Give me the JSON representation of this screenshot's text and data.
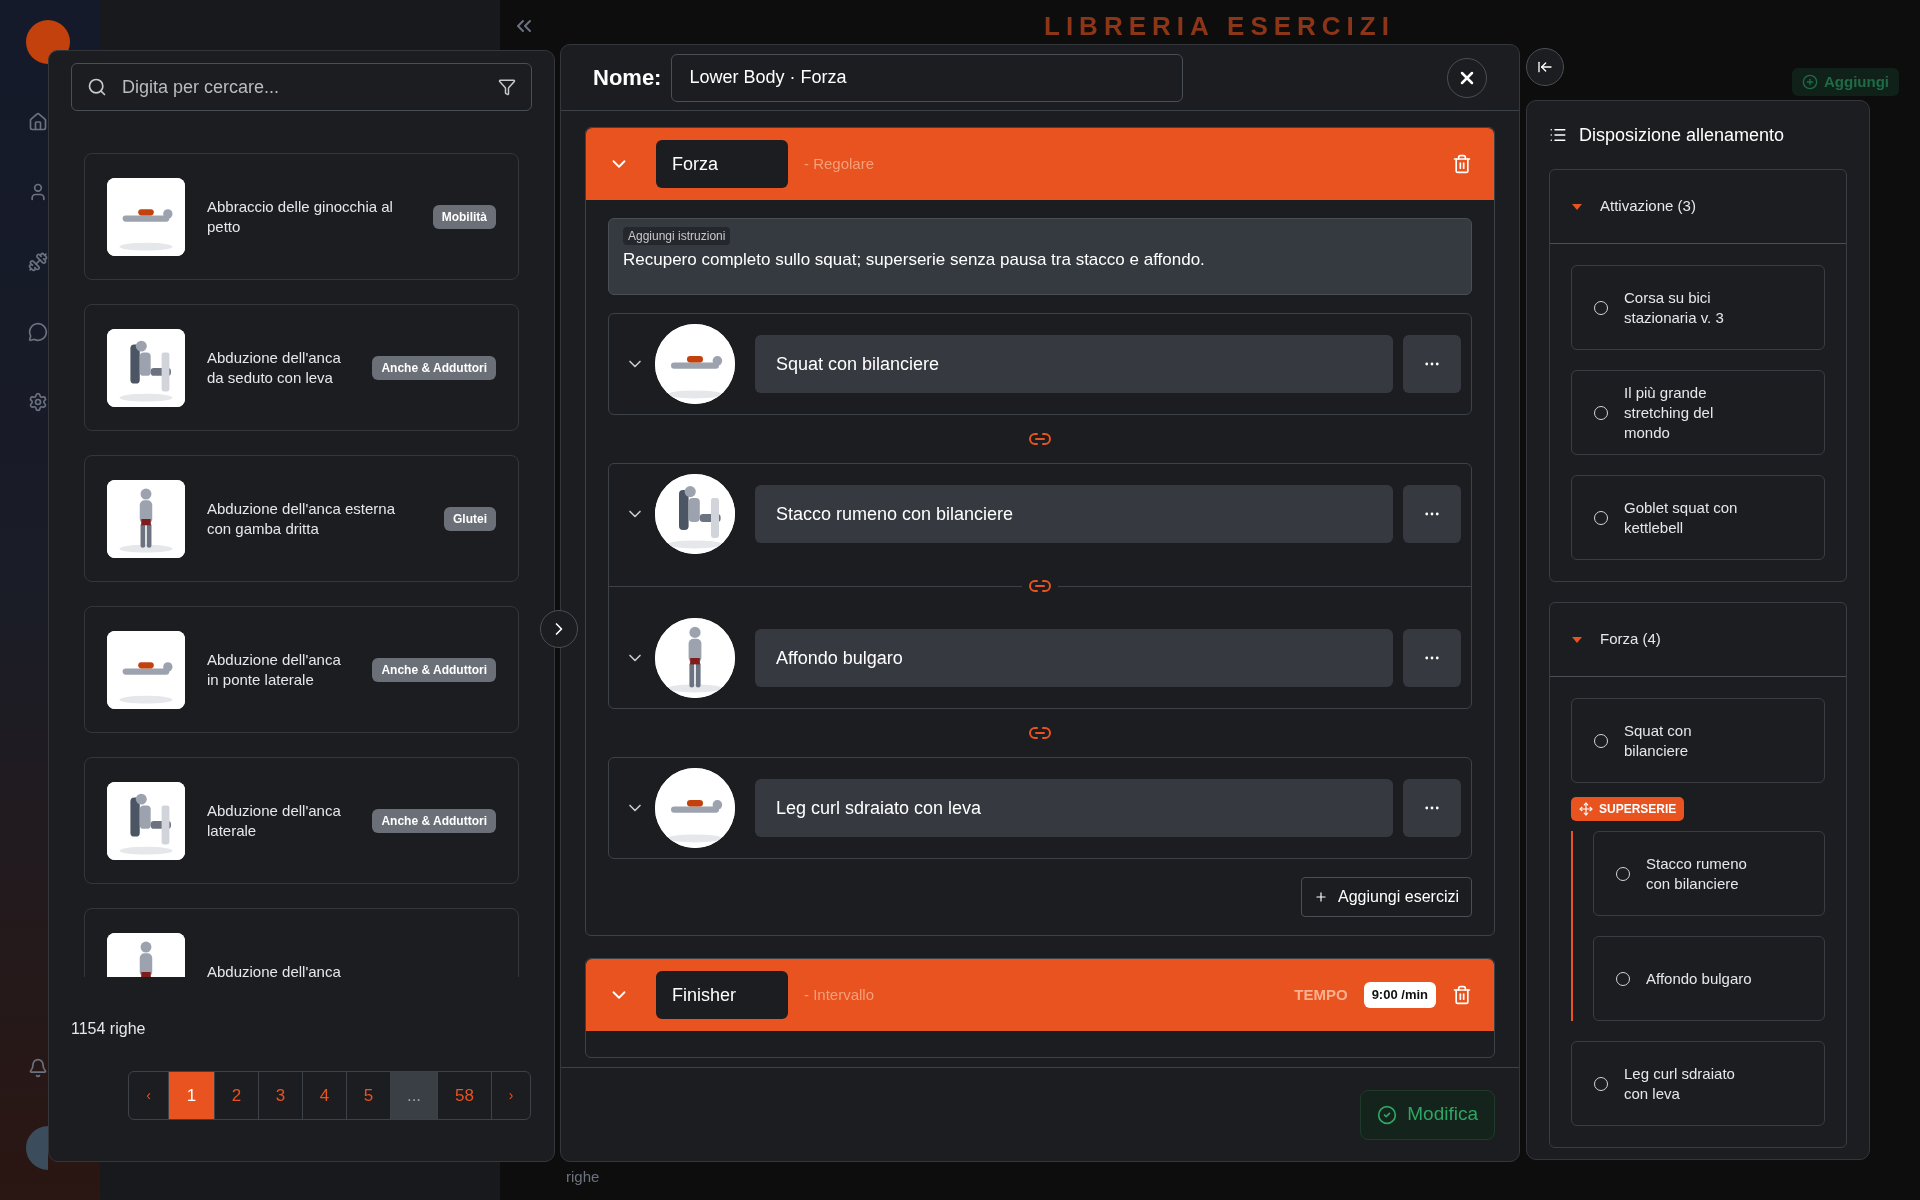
{
  "background": {
    "title": "LIBRERIA ESERCIZI",
    "add_button": "Aggiungi",
    "row_count_fragment": "righe"
  },
  "library": {
    "search": {
      "placeholder": "Digita per cercare..."
    },
    "items": [
      {
        "name": "Abbraccio delle ginocchia al petto",
        "tag": "Mobilità"
      },
      {
        "name": "Abduzione dell'anca da seduto con leva",
        "tag": "Anche & Adduttori"
      },
      {
        "name": "Abduzione dell'anca esterna con gamba dritta",
        "tag": "Glutei"
      },
      {
        "name": "Abduzione dell'anca in ponte laterale",
        "tag": "Anche & Adduttori"
      },
      {
        "name": "Abduzione dell'anca laterale",
        "tag": "Anche & Adduttori"
      },
      {
        "name": "Abduzione dell'anca"
      }
    ],
    "row_count": "1154 righe",
    "pagination": {
      "prev": "‹",
      "next": "›",
      "pages": [
        {
          "label": "1",
          "kind": "page",
          "selected": true
        },
        {
          "label": "2",
          "kind": "page",
          "selected": false
        },
        {
          "label": "3",
          "kind": "page",
          "selected": false
        },
        {
          "label": "4",
          "kind": "page",
          "selected": false
        },
        {
          "label": "5",
          "kind": "page",
          "selected": false
        },
        {
          "label": "...",
          "kind": "ellipsis"
        },
        {
          "label": "58",
          "kind": "page",
          "selected": false
        }
      ]
    }
  },
  "workout": {
    "name_label": "Nome:",
    "name_value": "Lower Body · Forza",
    "sections": [
      {
        "title": "Forza",
        "type": "- Regolare",
        "instructions_label": "Aggiungi istruzioni",
        "instructions": "Recupero completo sullo squat; superserie senza pausa tra stacco e affondo.",
        "groups": [
          [
            "Squat con bilanciere"
          ],
          [
            "Stacco rumeno con bilanciere",
            "Affondo bulgaro"
          ],
          [
            "Leg curl sdraiato con leva"
          ]
        ],
        "add_button": "Aggiungi esercizi"
      },
      {
        "title": "Finisher",
        "type": "- Intervallo",
        "tempo_label": "TEMPO",
        "tempo": "9:00 /min"
      }
    ],
    "save_button": "Modifica"
  },
  "layout": {
    "title": "Disposizione allenamento",
    "groups": [
      {
        "title": "Attivazione (3)",
        "items": [
          {
            "kind": "exercise",
            "name": "Corsa su bici stazionaria v. 3",
            "checked": false
          },
          {
            "kind": "exercise",
            "name": "Il più grande stretching del mondo",
            "checked": false
          },
          {
            "kind": "exercise",
            "name": "Goblet squat con kettlebell",
            "checked": false
          }
        ]
      },
      {
        "title": "Forza (4)",
        "items": [
          {
            "kind": "exercise",
            "name": "Squat con bilanciere",
            "checked": false
          },
          {
            "kind": "superset",
            "label": "SUPERSERIE",
            "items": [
              {
                "name": "Stacco rumeno con bilanciere",
                "checked": false
              },
              {
                "name": "Affondo bulgaro",
                "checked": false
              }
            ]
          },
          {
            "kind": "exercise",
            "name": "Leg curl sdraiato con leva",
            "checked": false
          }
        ]
      }
    ]
  }
}
